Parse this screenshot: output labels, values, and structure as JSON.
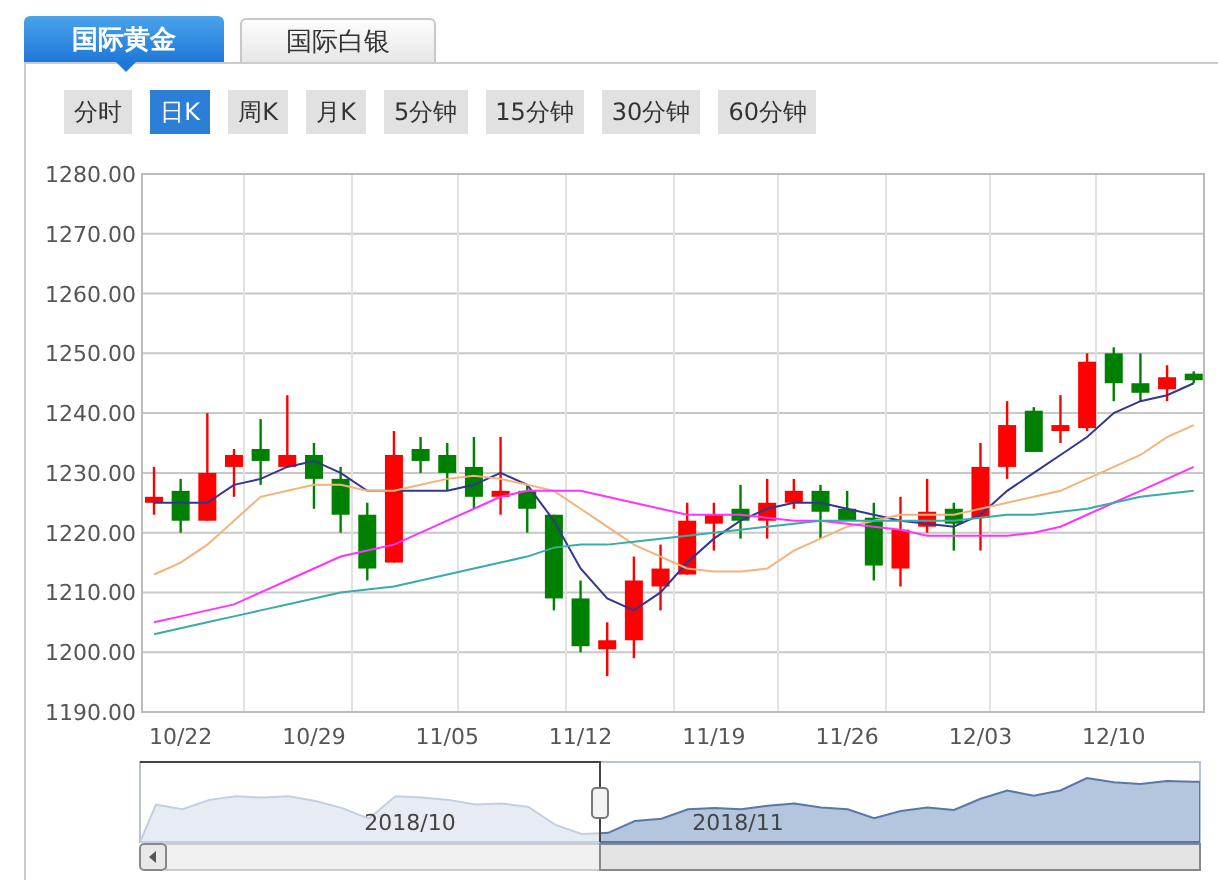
{
  "tabs": [
    {
      "label": "国际黄金",
      "selected": true
    },
    {
      "label": "国际白银",
      "selected": false
    }
  ],
  "periods": [
    {
      "label": "分时",
      "selected": false
    },
    {
      "label": "日K",
      "selected": true
    },
    {
      "label": "周K",
      "selected": false
    },
    {
      "label": "月K",
      "selected": false
    },
    {
      "label": "5分钟",
      "selected": false
    },
    {
      "label": "15分钟",
      "selected": false
    },
    {
      "label": "30分钟",
      "selected": false
    },
    {
      "label": "60分钟",
      "selected": false
    }
  ],
  "chart": {
    "chart_data": {
      "type": "candlestick",
      "grid": true,
      "ylim": [
        1190,
        1280
      ],
      "yticks": [
        {
          "value": 1280,
          "label": "1280.00"
        },
        {
          "value": 1270,
          "label": "1270.00"
        },
        {
          "value": 1260,
          "label": "1260.00"
        },
        {
          "value": 1250,
          "label": "1250.00"
        },
        {
          "value": 1240,
          "label": "1240.00"
        },
        {
          "value": 1230,
          "label": "1230.00"
        },
        {
          "value": 1220,
          "label": "1220.00"
        },
        {
          "value": 1210,
          "label": "1210.00"
        },
        {
          "value": 1200,
          "label": "1200.00"
        },
        {
          "value": 1190,
          "label": "1190.00"
        }
      ],
      "categories": [
        null,
        "10/22",
        null,
        null,
        null,
        null,
        "10/29",
        null,
        null,
        null,
        null,
        "11/05",
        null,
        null,
        null,
        null,
        "11/12",
        null,
        null,
        null,
        null,
        "11/19",
        null,
        null,
        null,
        null,
        "11/26",
        null,
        null,
        null,
        null,
        "12/03",
        null,
        null,
        null,
        null,
        "12/10",
        null,
        null,
        null
      ],
      "ohlc": [
        [
          1225,
          1231,
          1223,
          1226
        ],
        [
          1227,
          1229,
          1220,
          1222
        ],
        [
          1222,
          1240,
          1222,
          1230
        ],
        [
          1231,
          1234,
          1226,
          1233
        ],
        [
          1234,
          1239,
          1228,
          1232
        ],
        [
          1231,
          1243,
          1231,
          1233
        ],
        [
          1233,
          1235,
          1224,
          1229
        ],
        [
          1229,
          1231,
          1220,
          1223
        ],
        [
          1223,
          1225,
          1212,
          1214
        ],
        [
          1215,
          1237,
          1215,
          1233
        ],
        [
          1234,
          1236,
          1230,
          1232
        ],
        [
          1233,
          1235,
          1227,
          1230
        ],
        [
          1231,
          1236,
          1224,
          1226
        ],
        [
          1226,
          1236,
          1223,
          1227
        ],
        [
          1227,
          1228,
          1220,
          1224
        ],
        [
          1223,
          1223,
          1207,
          1209
        ],
        [
          1209,
          1212,
          1200,
          1201
        ],
        [
          1200.5,
          1205,
          1196,
          1202
        ],
        [
          1202,
          1216,
          1199,
          1212
        ],
        [
          1211,
          1218,
          1207,
          1214
        ],
        [
          1213,
          1225,
          1213,
          1222
        ],
        [
          1221.5,
          1225,
          1217,
          1223
        ],
        [
          1224,
          1228,
          1219,
          1222
        ],
        [
          1222,
          1229,
          1219,
          1225
        ],
        [
          1225,
          1229,
          1224,
          1227
        ],
        [
          1227,
          1228,
          1219,
          1223.5
        ],
        [
          1224,
          1227,
          1222,
          1222
        ],
        [
          1222.5,
          1225,
          1212,
          1214.5
        ],
        [
          1214,
          1226,
          1211,
          1220.5
        ],
        [
          1221,
          1229,
          1220,
          1223.5
        ],
        [
          1224,
          1225,
          1217,
          1221.5
        ],
        [
          1222.5,
          1235,
          1217,
          1231
        ],
        [
          1231,
          1242,
          1229,
          1238
        ],
        [
          1240.4,
          1241,
          1233.5,
          1233.5
        ],
        [
          1237,
          1243,
          1235,
          1238
        ],
        [
          1237.5,
          1250,
          1237,
          1248.6
        ],
        [
          1250,
          1251,
          1242,
          1245
        ],
        [
          1245,
          1250,
          1242,
          1243.4
        ],
        [
          1244,
          1248,
          1242,
          1246
        ],
        [
          1246.6,
          1247,
          1245,
          1245.5
        ]
      ],
      "series": [
        {
          "type": "line",
          "color": "#34368f",
          "values": [
            1225,
            1225,
            1225,
            1228,
            1229,
            1231,
            1232,
            1230,
            1227,
            1227,
            1227,
            1227,
            1228,
            1230,
            1228,
            1222,
            1214,
            1209,
            1207,
            1210,
            1215,
            1219,
            1222,
            1224,
            1225,
            1225,
            1224,
            1223,
            1222,
            1221.5,
            1221,
            1223,
            1227,
            1230,
            1233,
            1236,
            1240,
            1242,
            1243,
            1245
          ]
        },
        {
          "type": "line",
          "color": "#f5b27a",
          "values": [
            1213,
            1215,
            1218,
            1222,
            1226,
            1227,
            1228,
            1228,
            1227,
            1227,
            1228,
            1229,
            1229.5,
            1229,
            1228,
            1227,
            1224,
            1221,
            1218,
            1216,
            1214,
            1213.5,
            1213.5,
            1214,
            1217,
            1219,
            1221,
            1222,
            1223,
            1223,
            1223,
            1224,
            1225,
            1226,
            1227,
            1229,
            1231,
            1233,
            1236,
            1238
          ]
        },
        {
          "type": "line",
          "color": "#ff33ff",
          "values": [
            1205,
            1206,
            1207,
            1208,
            1210,
            1212,
            1214,
            1216,
            1217,
            1218,
            1220,
            1222,
            1224,
            1226,
            1227,
            1227,
            1227,
            1226,
            1225,
            1224,
            1223,
            1223,
            1223,
            1222.5,
            1222,
            1222,
            1221.5,
            1221,
            1220.5,
            1219.5,
            1219.5,
            1219.5,
            1219.5,
            1220,
            1221,
            1223,
            1225,
            1227,
            1229,
            1231
          ]
        },
        {
          "type": "line",
          "color": "#3aaaaa",
          "values": [
            1203,
            1204,
            1205,
            1206,
            1207,
            1208,
            1209,
            1210,
            1210.5,
            1211,
            1212,
            1213,
            1214,
            1215,
            1216,
            1217.5,
            1218,
            1218,
            1218.5,
            1219,
            1219.5,
            1220,
            1220.5,
            1221,
            1221.5,
            1222,
            1222,
            1222,
            1222,
            1222,
            1222,
            1222.5,
            1223,
            1223,
            1223.5,
            1224,
            1225,
            1226,
            1226.5,
            1227
          ]
        }
      ]
    }
  },
  "navigator": {
    "labels": [
      "2018/10",
      "2018/11"
    ]
  }
}
